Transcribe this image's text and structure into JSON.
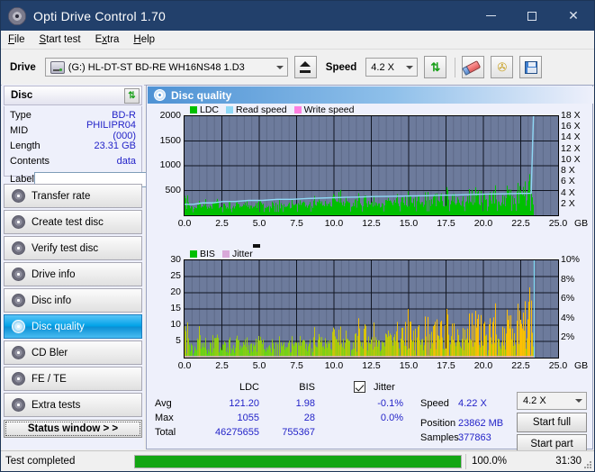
{
  "window": {
    "title": "Opti Drive Control 1.70",
    "icon": "disc-icon",
    "minimize": "–",
    "maximize": "□",
    "close": "✕"
  },
  "menu": [
    {
      "label": "File",
      "accel": "F"
    },
    {
      "label": "Start test",
      "accel": "S"
    },
    {
      "label": "Extra",
      "accel": "x"
    },
    {
      "label": "Help",
      "accel": "H"
    }
  ],
  "toolbar": {
    "drive_label": "Drive",
    "drive_value": "(G:)  HL-DT-ST BD-RE  WH16NS48 1.D3",
    "eject_tooltip": "Eject",
    "speed_label": "Speed",
    "speed_value": "4.2 X",
    "refresh_icon": "refresh-icon",
    "erase_icon": "erase-icon",
    "tools_icon": "tools-icon",
    "save_icon": "save-icon"
  },
  "disc_panel": {
    "title": "Disc",
    "refresh_icon": "refresh-icon",
    "rows": [
      {
        "key": "Type",
        "value": "BD-R"
      },
      {
        "key": "MID",
        "value": "PHILIPR04 (000)"
      },
      {
        "key": "Length",
        "value": "23.31 GB"
      },
      {
        "key": "Contents",
        "value": "data"
      }
    ],
    "label_key": "Label",
    "label_value": "",
    "label_placeholder": "",
    "disc_icon": "disc-icon"
  },
  "nav": {
    "items": [
      {
        "label": "Transfer rate",
        "selected": false
      },
      {
        "label": "Create test disc",
        "selected": false
      },
      {
        "label": "Verify test disc",
        "selected": false
      },
      {
        "label": "Drive info",
        "selected": false
      },
      {
        "label": "Disc info",
        "selected": false
      },
      {
        "label": "Disc quality",
        "selected": true
      },
      {
        "label": "CD Bler",
        "selected": false
      },
      {
        "label": "FE / TE",
        "selected": false
      },
      {
        "label": "Extra tests",
        "selected": false
      }
    ],
    "status_window": "Status window > >"
  },
  "content": {
    "header": "Disc quality",
    "header_icon": "disc-quality-icon"
  },
  "chart_data": [
    {
      "type": "area",
      "title": "Disc quality - LDC / Read speed",
      "xlabel": "GB",
      "ylabel": "LDC",
      "y2label": "X",
      "xlim": [
        0,
        25
      ],
      "ylim": [
        0,
        2000
      ],
      "y2lim": [
        0,
        18
      ],
      "grid": true,
      "legend_position": "top-left",
      "legend": [
        {
          "name": "LDC",
          "color": "#00c000"
        },
        {
          "name": "Read speed",
          "color": "#8fd8f5"
        },
        {
          "name": "Write speed",
          "color": "#ff7fe0"
        }
      ],
      "xticks": [
        "0.0",
        "2.5",
        "5.0",
        "7.5",
        "10.0",
        "12.5",
        "15.0",
        "17.5",
        "20.0",
        "22.5",
        "25.0"
      ],
      "xtick_values": [
        0,
        2.5,
        5,
        7.5,
        10,
        12.5,
        15,
        17.5,
        20,
        22.5,
        25
      ],
      "yticks": [
        "500",
        "1000",
        "1500",
        "2000"
      ],
      "ytick_values": [
        500,
        1000,
        1500,
        2000
      ],
      "y2ticks": [
        "2 X",
        "4 X",
        "6 X",
        "8 X",
        "10 X",
        "12 X",
        "14 X",
        "16 X",
        "18 X"
      ],
      "y2tick_values": [
        2,
        4,
        6,
        8,
        10,
        12,
        14,
        16,
        18
      ],
      "data_end_x": 23.4,
      "series": [
        {
          "name": "LDC",
          "color": "#00c000",
          "x": [
            0.0,
            0.2,
            0.4,
            0.6,
            0.8,
            1.0,
            1.2,
            1.4,
            1.6,
            1.8,
            2.0,
            2.2,
            2.4,
            2.6,
            2.8,
            3.0,
            3.2,
            3.4,
            3.6,
            3.8,
            4.0,
            4.2,
            4.4,
            4.6,
            4.8,
            5.0,
            5.2,
            5.4,
            5.6,
            5.8,
            6.0,
            6.2,
            6.4,
            6.6,
            6.8,
            7.0,
            7.2,
            7.4,
            7.6,
            7.8,
            8.0,
            8.2,
            8.4,
            8.6,
            8.8,
            9.0,
            9.2,
            9.4,
            9.6,
            9.8,
            10.0,
            10.2,
            10.4,
            10.6,
            10.8,
            11.0,
            11.2,
            11.4,
            11.6,
            11.8,
            12.0,
            12.2,
            12.4,
            12.6,
            12.8,
            13.0,
            13.2,
            13.4,
            13.6,
            13.8,
            14.0,
            14.2,
            14.4,
            14.6,
            14.8,
            15.0,
            15.2,
            15.4,
            15.6,
            15.8,
            16.0,
            16.2,
            16.4,
            16.6,
            16.8,
            17.0,
            17.2,
            17.4,
            17.6,
            17.8,
            18.0,
            18.2,
            18.4,
            18.6,
            18.8,
            19.0,
            19.2,
            19.4,
            19.6,
            19.8,
            20.0,
            20.2,
            20.4,
            20.6,
            20.8,
            21.0,
            21.2,
            21.4,
            21.6,
            21.8,
            22.0,
            22.2,
            22.4,
            22.6,
            22.8,
            23.0,
            23.2,
            23.4
          ],
          "values": [
            330,
            430,
            210,
            260,
            180,
            310,
            200,
            350,
            240,
            190,
            320,
            480,
            230,
            280,
            200,
            340,
            190,
            260,
            300,
            210,
            250,
            330,
            220,
            190,
            270,
            360,
            230,
            200,
            300,
            250,
            420,
            230,
            320,
            260,
            200,
            300,
            380,
            240,
            310,
            270,
            350,
            230,
            300,
            440,
            260,
            330,
            290,
            380,
            250,
            320,
            480,
            300,
            680,
            360,
            420,
            300,
            450,
            330,
            590,
            340,
            380,
            450,
            300,
            370,
            320,
            290,
            380,
            330,
            420,
            300,
            360,
            480,
            330,
            400,
            360,
            610,
            340,
            420,
            380,
            450,
            330,
            620,
            400,
            360,
            480,
            340,
            500,
            380,
            700,
            420,
            560,
            380,
            460,
            520,
            400,
            620,
            440,
            700,
            480,
            540,
            420,
            580,
            500,
            620,
            540,
            470,
            600,
            520,
            680,
            560,
            620,
            700,
            740,
            860,
            900,
            1010,
            860,
            1055
          ]
        },
        {
          "name": "Read speed",
          "color": "#8fd8f5",
          "x": [
            0.0,
            0.6,
            1.2,
            1.9,
            2.6,
            3.4,
            4.3,
            5.2,
            6.2,
            7.2,
            8.3,
            9.4,
            10.5,
            11.6,
            12.7,
            13.9,
            15.0,
            16.1,
            17.2,
            18.3,
            19.4,
            20.4,
            21.4,
            22.3,
            23.2,
            23.35,
            23.4
          ],
          "values": [
            2.0,
            2.0,
            2.25,
            2.25,
            2.5,
            2.5,
            2.7,
            2.7,
            2.9,
            2.9,
            3.05,
            3.15,
            3.25,
            3.3,
            3.4,
            3.45,
            3.5,
            3.55,
            3.65,
            3.7,
            3.8,
            3.85,
            3.9,
            3.95,
            4.0,
            18.0,
            18.0
          ]
        }
      ]
    },
    {
      "type": "area",
      "title": "Disc quality - BIS / Jitter",
      "xlabel": "GB",
      "ylabel": "BIS",
      "y2label": "%",
      "xlim": [
        0,
        25
      ],
      "ylim": [
        0,
        30
      ],
      "y2lim": [
        0,
        10
      ],
      "grid": true,
      "legend_position": "top-left",
      "legend": [
        {
          "name": "BIS",
          "color": "#00c000"
        },
        {
          "name": "Jitter",
          "color": "#d9a8d9"
        }
      ],
      "xticks": [
        "0.0",
        "2.5",
        "5.0",
        "7.5",
        "10.0",
        "12.5",
        "15.0",
        "17.5",
        "20.0",
        "22.5",
        "25.0"
      ],
      "xtick_values": [
        0,
        2.5,
        5,
        7.5,
        10,
        12.5,
        15,
        17.5,
        20,
        22.5,
        25
      ],
      "yticks": [
        "5",
        "10",
        "15",
        "20",
        "25",
        "30"
      ],
      "ytick_values": [
        5,
        10,
        15,
        20,
        25,
        30
      ],
      "y2ticks": [
        "2%",
        "4%",
        "6%",
        "8%",
        "10%"
      ],
      "y2tick_values": [
        2,
        4,
        6,
        8,
        10
      ],
      "data_end_x": 23.4,
      "series": [
        {
          "name": "BIS",
          "color": "#55dd22",
          "x": [
            0.0,
            0.2,
            0.4,
            0.6,
            0.8,
            1.0,
            1.2,
            1.4,
            1.6,
            1.8,
            2.0,
            2.2,
            2.4,
            2.6,
            2.8,
            3.0,
            3.2,
            3.4,
            3.6,
            3.8,
            4.0,
            4.2,
            4.4,
            4.6,
            4.8,
            5.0,
            5.2,
            5.4,
            5.6,
            5.8,
            6.0,
            6.2,
            6.4,
            6.6,
            6.8,
            7.0,
            7.2,
            7.4,
            7.6,
            7.8,
            8.0,
            8.2,
            8.4,
            8.6,
            8.8,
            9.0,
            9.2,
            9.4,
            9.6,
            9.8,
            10.0,
            10.2,
            10.4,
            10.6,
            10.8,
            11.0,
            11.2,
            11.4,
            11.6,
            11.8,
            12.0,
            12.2,
            12.4,
            12.6,
            12.8,
            13.0,
            13.2,
            13.4,
            13.6,
            13.8,
            14.0,
            14.2,
            14.4,
            14.6,
            14.8,
            15.0,
            15.2,
            15.4,
            15.6,
            15.8,
            16.0,
            16.2,
            16.4,
            16.6,
            16.8,
            17.0,
            17.2,
            17.4,
            17.6,
            17.8,
            18.0,
            18.2,
            18.4,
            18.6,
            18.8,
            19.0,
            19.2,
            19.4,
            19.6,
            19.8,
            20.0,
            20.2,
            20.4,
            20.6,
            20.8,
            21.0,
            21.2,
            21.4,
            21.6,
            21.8,
            22.0,
            22.2,
            22.4,
            22.6,
            22.8,
            23.0,
            23.2,
            23.4
          ],
          "values": [
            8,
            12,
            6,
            9,
            5,
            11,
            6,
            7,
            5,
            6,
            9,
            12,
            6,
            5,
            7,
            8,
            5,
            6,
            9,
            5,
            6,
            8,
            5,
            6,
            7,
            9,
            5,
            6,
            8,
            6,
            9,
            5,
            7,
            6,
            5,
            7,
            9,
            6,
            7,
            6,
            8,
            6,
            7,
            11,
            6,
            8,
            7,
            9,
            6,
            7,
            11,
            7,
            13,
            9,
            10,
            7,
            11,
            8,
            18,
            9,
            10,
            12,
            8,
            10,
            9,
            8,
            10,
            9,
            11,
            8,
            10,
            13,
            9,
            11,
            10,
            21,
            9,
            11,
            10,
            12,
            9,
            18,
            11,
            10,
            13,
            9,
            14,
            10,
            20,
            12,
            15,
            10,
            12,
            14,
            11,
            17,
            12,
            19,
            13,
            15,
            11,
            16,
            14,
            17,
            15,
            13,
            16,
            14,
            18,
            15,
            17,
            19,
            20,
            23,
            25,
            28,
            24,
            28
          ]
        },
        {
          "name": "Jitter",
          "color": "#d9a8d9",
          "x": [
            0.0,
            23.4
          ],
          "values": [
            0.0,
            0.0
          ]
        }
      ]
    }
  ],
  "stats": {
    "col_headers": [
      "LDC",
      "BIS"
    ],
    "jitter_label": "Jitter",
    "jitter_checked": true,
    "rows": [
      {
        "label": "Avg",
        "ldc": "121.20",
        "bis": "1.98",
        "jitter": "-0.1%"
      },
      {
        "label": "Max",
        "ldc": "1055",
        "bis": "28",
        "jitter": "0.0%"
      },
      {
        "label": "Total",
        "ldc": "46275655",
        "bis": "755367",
        "jitter": ""
      }
    ],
    "speed_label": "Speed",
    "speed_value": "4.22 X",
    "position_label": "Position",
    "position_value": "23862 MB",
    "samples_label": "Samples",
    "samples_value": "377863",
    "speed_select": "4.2 X",
    "start_full": "Start full",
    "start_part": "Start part"
  },
  "statusbar": {
    "message": "Test completed",
    "progress_percent": 100.0,
    "progress_text": "100.0%",
    "elapsed": "31:30"
  }
}
